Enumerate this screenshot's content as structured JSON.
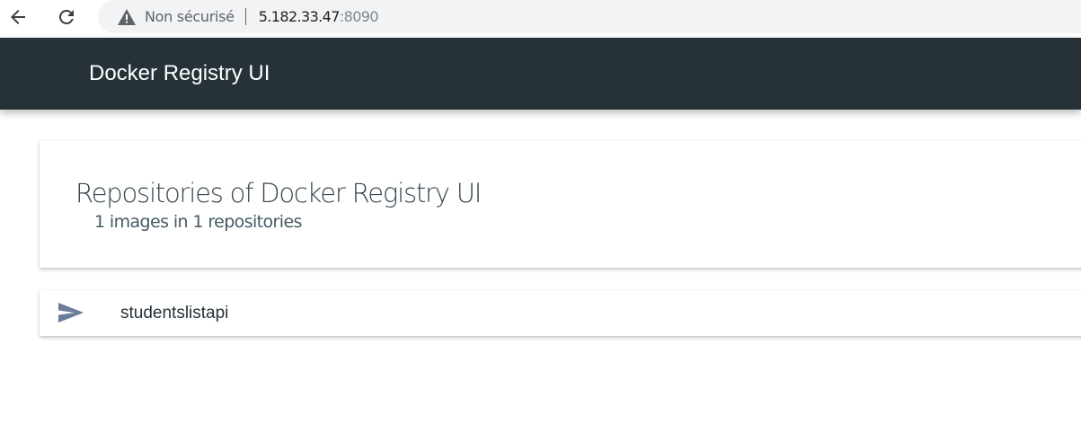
{
  "browser": {
    "security_label": "Non sécurisé",
    "url_host": "5.182.33.47",
    "url_port": ":8090",
    "back_icon": "arrow-left-icon",
    "reload_icon": "reload-icon",
    "warning_icon": "warning-triangle-icon"
  },
  "header": {
    "title": "Docker Registry UI",
    "background_color": "#263238"
  },
  "repositories": {
    "title": "Repositories of Docker Registry UI",
    "subtitle": "1 images in 1 repositories",
    "items": [
      {
        "icon": "send-icon",
        "name": "studentslistapi"
      }
    ]
  },
  "colors": {
    "icon_color": "#6b7d9a",
    "header_text": "#ffffff"
  }
}
